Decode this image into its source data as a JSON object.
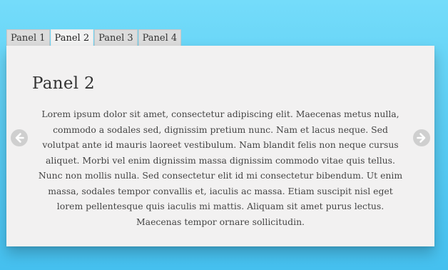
{
  "tabs": [
    {
      "label": "Panel 1"
    },
    {
      "label": "Panel 2"
    },
    {
      "label": "Panel 3"
    },
    {
      "label": "Panel 4"
    }
  ],
  "active_tab_index": 1,
  "panel": {
    "title": "Panel 2",
    "body": "Lorem ipsum dolor sit amet, consectetur adipiscing elit. Maecenas metus nulla, commodo a sodales sed, dignissim pretium nunc. Nam et lacus neque. Sed volutpat ante id mauris laoreet vestibulum. Nam blandit felis non neque cursus aliquet. Morbi vel enim dignissim massa dignissim commodo vitae quis tellus. Nunc non mollis nulla. Sed consectetur elit id mi consectetur bibendum. Ut enim massa, sodales tempor convallis et, iaculis ac massa. Etiam suscipit nisl eget lorem pellentesque quis iaculis mi mattis. Aliquam sit amet purus lectus. Maecenas tempor ornare sollicitudin."
  },
  "navigation": {
    "prev_icon": "arrow-left-circle-icon",
    "next_icon": "arrow-right-circle-icon"
  },
  "colors": {
    "background_top": "#74dcfa",
    "background_bottom": "#45c0ef",
    "panel_background": "#f2f1f1",
    "tab_inactive": "#dcdcdc",
    "tab_active": "#f2f2f2",
    "arrow": "#cfcfcf"
  }
}
